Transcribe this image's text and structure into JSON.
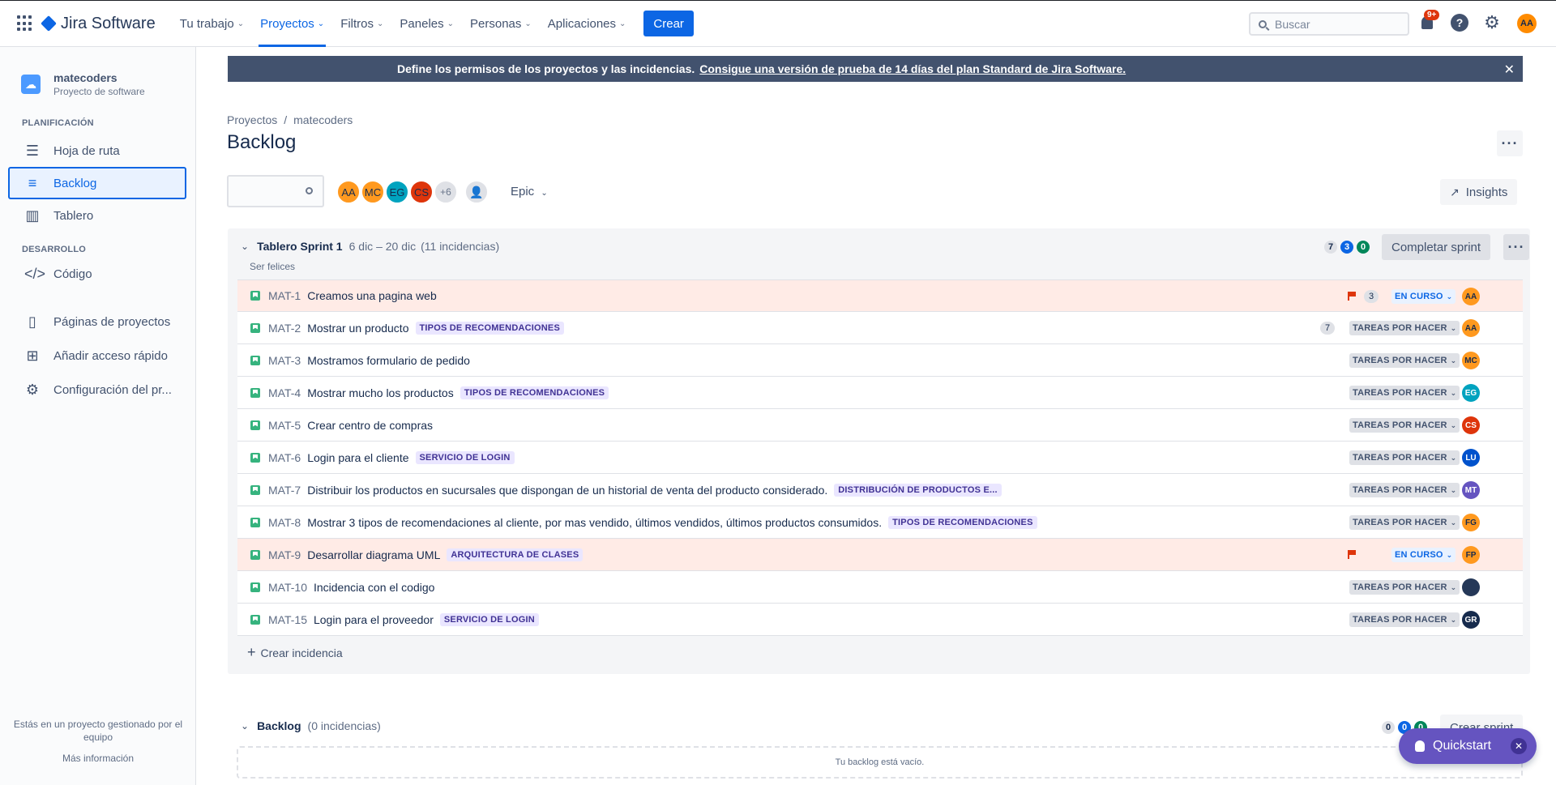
{
  "topnav": {
    "product": "Jira Software",
    "items": [
      {
        "label": "Tu trabajo",
        "active": false
      },
      {
        "label": "Proyectos",
        "active": true
      },
      {
        "label": "Filtros",
        "active": false
      },
      {
        "label": "Paneles",
        "active": false
      },
      {
        "label": "Personas",
        "active": false
      },
      {
        "label": "Aplicaciones",
        "active": false
      }
    ],
    "create_label": "Crear",
    "search_placeholder": "Buscar",
    "notifications_badge": "9+",
    "user_initials": "AA"
  },
  "sidebar": {
    "project_name": "matecoders",
    "project_type": "Proyecto de software",
    "planning_label": "PLANIFICACIÓN",
    "dev_label": "DESARROLLO",
    "items": [
      {
        "label": "Hoja de ruta",
        "icon": "roadmap-icon"
      },
      {
        "label": "Backlog",
        "icon": "backlog-icon"
      },
      {
        "label": "Tablero",
        "icon": "board-icon"
      },
      {
        "label": "Código",
        "icon": "code-icon"
      },
      {
        "label": "Páginas de proyectos",
        "icon": "pages-icon"
      },
      {
        "label": "Añadir acceso rápido",
        "icon": "add-shortcut-icon"
      },
      {
        "label": "Configuración del pr...",
        "icon": "settings-icon"
      }
    ],
    "footer_text": "Estás en un proyecto gestionado por el equipo",
    "footer_link": "Más información"
  },
  "banner": {
    "text": "Define los permisos de los proyectos y las incidencias.",
    "link": "Consigue una versión de prueba de 14 días del plan Standard de Jira Software."
  },
  "breadcrumb": {
    "root": "Proyectos",
    "project": "matecoders",
    "separator": "/"
  },
  "page_title": "Backlog",
  "toolbar": {
    "avatars": [
      {
        "initials": "AA",
        "color": "#ff991f"
      },
      {
        "initials": "MC",
        "color": "#ff991f"
      },
      {
        "initials": "EG",
        "color": "#00a3bf"
      },
      {
        "initials": "CS",
        "color": "#de350b"
      }
    ],
    "more_avatars": "+6",
    "epic_label": "Epic",
    "insights_label": "Insights"
  },
  "sprint": {
    "name": "Tablero Sprint 1",
    "dates": "6 dic – 20 dic",
    "count": "(11 incidencias)",
    "goal": "Ser felices",
    "todo_count": "7",
    "progress_count": "3",
    "done_count": "0",
    "complete_label": "Completar sprint",
    "create_issue_label": "Crear incidencia"
  },
  "issues": [
    {
      "key": "MAT-1",
      "summary": "Creamos una pagina web",
      "epic": "",
      "flagged": true,
      "estimate": "3",
      "status": "EN CURSO",
      "assignee": "AA",
      "assignee_color": "#ff991f"
    },
    {
      "key": "MAT-2",
      "summary": "Mostrar un producto",
      "epic": "TIPOS DE RECOMENDACIONES",
      "flagged": false,
      "estimate": "7",
      "status": "TAREAS POR HACER",
      "assignee": "AA",
      "assignee_color": "#ff991f"
    },
    {
      "key": "MAT-3",
      "summary": "Mostramos formulario de pedido",
      "epic": "",
      "flagged": false,
      "estimate": "",
      "status": "TAREAS POR HACER",
      "assignee": "MC",
      "assignee_color": "#ff991f"
    },
    {
      "key": "MAT-4",
      "summary": "Mostrar mucho los productos",
      "epic": "TIPOS DE RECOMENDACIONES",
      "flagged": false,
      "estimate": "",
      "status": "TAREAS POR HACER",
      "assignee": "EG",
      "assignee_color": "#00a3bf"
    },
    {
      "key": "MAT-5",
      "summary": "Crear centro de compras",
      "epic": "",
      "flagged": false,
      "estimate": "",
      "status": "TAREAS POR HACER",
      "assignee": "CS",
      "assignee_color": "#de350b"
    },
    {
      "key": "MAT-6",
      "summary": "Login para el cliente",
      "epic": "SERVICIO DE LOGIN",
      "flagged": false,
      "estimate": "",
      "status": "TAREAS POR HACER",
      "assignee": "LU",
      "assignee_color": "#0052cc"
    },
    {
      "key": "MAT-7",
      "summary": "Distribuir los productos en sucursales que dispongan de un historial de venta del producto considerado.",
      "epic": "DISTRIBUCIÓN DE PRODUCTOS E...",
      "flagged": false,
      "estimate": "",
      "status": "TAREAS POR HACER",
      "assignee": "MT",
      "assignee_color": "#6554c0"
    },
    {
      "key": "MAT-8",
      "summary": "Mostrar 3 tipos de recomendaciones al cliente, por mas vendido, últimos vendidos, últimos productos consumidos.",
      "epic": "TIPOS DE RECOMENDACIONES",
      "flagged": false,
      "estimate": "",
      "status": "TAREAS POR HACER",
      "assignee": "FG",
      "assignee_color": "#ff991f"
    },
    {
      "key": "MAT-9",
      "summary": "Desarrollar diagrama UML",
      "epic": "ARQUITECTURA DE CLASES",
      "flagged": true,
      "estimate": "",
      "status": "EN CURSO",
      "assignee": "FP",
      "assignee_color": "#ff991f"
    },
    {
      "key": "MAT-10",
      "summary": "Incidencia con el codigo",
      "epic": "",
      "flagged": false,
      "estimate": "",
      "status": "TAREAS POR HACER",
      "assignee": "",
      "assignee_color": "#253858"
    },
    {
      "key": "MAT-15",
      "summary": "Login para el proveedor",
      "epic": "SERVICIO DE LOGIN",
      "flagged": false,
      "estimate": "",
      "status": "TAREAS POR HACER",
      "assignee": "GR",
      "assignee_color": "#172b4d"
    }
  ],
  "backlog": {
    "name": "Backlog",
    "count": "(0 incidencias)",
    "todo_count": "0",
    "progress_count": "0",
    "done_count": "0",
    "create_sprint_label": "Crear sprint",
    "empty_text": "Tu backlog está vacío."
  },
  "quickstart": {
    "label": "Quickstart"
  }
}
